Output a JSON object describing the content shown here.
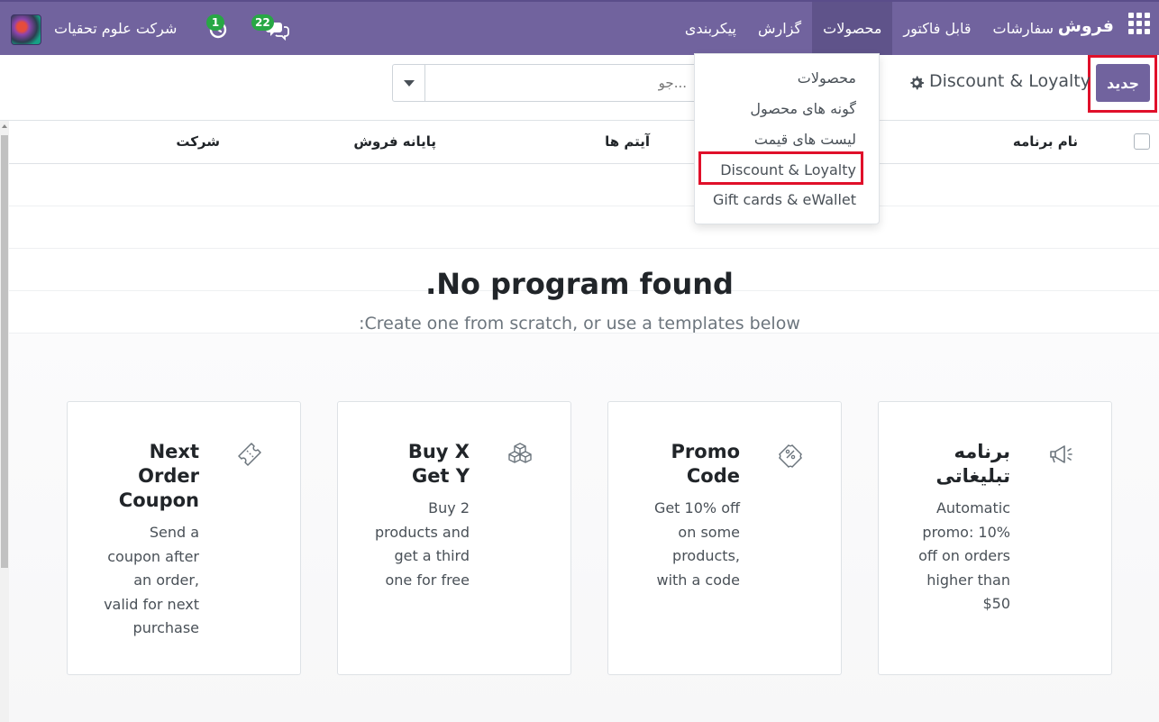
{
  "navbar": {
    "brand": "فروش",
    "menu": [
      {
        "label": "سفارشات"
      },
      {
        "label": "قابل فاکتور"
      },
      {
        "label": "محصولات"
      },
      {
        "label": "گزارش"
      },
      {
        "label": "پیکربندی"
      }
    ],
    "chat_count": "22",
    "activity_count": "1",
    "company": "شرکت علوم تحقیات"
  },
  "control_panel": {
    "new_label": "جدید",
    "breadcrumb": "Discount & Loyalty",
    "search_placeholder": "...جو"
  },
  "list": {
    "columns": {
      "name": "نام برنامه",
      "items": "آیتم ها",
      "pos": "پایانه فروش",
      "company": "شرکت"
    }
  },
  "help": {
    "title": ".No program found",
    "subtitle": ":Create one from scratch, or use a templates below"
  },
  "cards": [
    {
      "title": "برنامه تبلیغاتی",
      "description": "Automatic promo: 10% off on orders higher than $50",
      "icon": "megaphone-icon"
    },
    {
      "title": "Promo Code",
      "description": "Get 10% off on some products, with a code",
      "icon": "promo-ticket-icon"
    },
    {
      "title": "Buy X Get Y",
      "description": "Buy 2 products and get a third one for free",
      "icon": "cubes-icon"
    },
    {
      "title": "Next Order Coupon",
      "description": "Send a coupon after an order, valid for next purchase",
      "icon": "ticket-icon"
    }
  ],
  "products_dropdown": {
    "items": [
      {
        "label": "محصولات"
      },
      {
        "label": "گونه های محصول"
      },
      {
        "label": "لیست های قیمت"
      },
      {
        "label": "Discount & Loyalty"
      },
      {
        "label": "Gift cards & eWallet"
      }
    ]
  },
  "colors": {
    "navbar": "#71639e",
    "primary_button": "#71639e",
    "badge": "#28a745",
    "highlight": "#e0102a"
  }
}
